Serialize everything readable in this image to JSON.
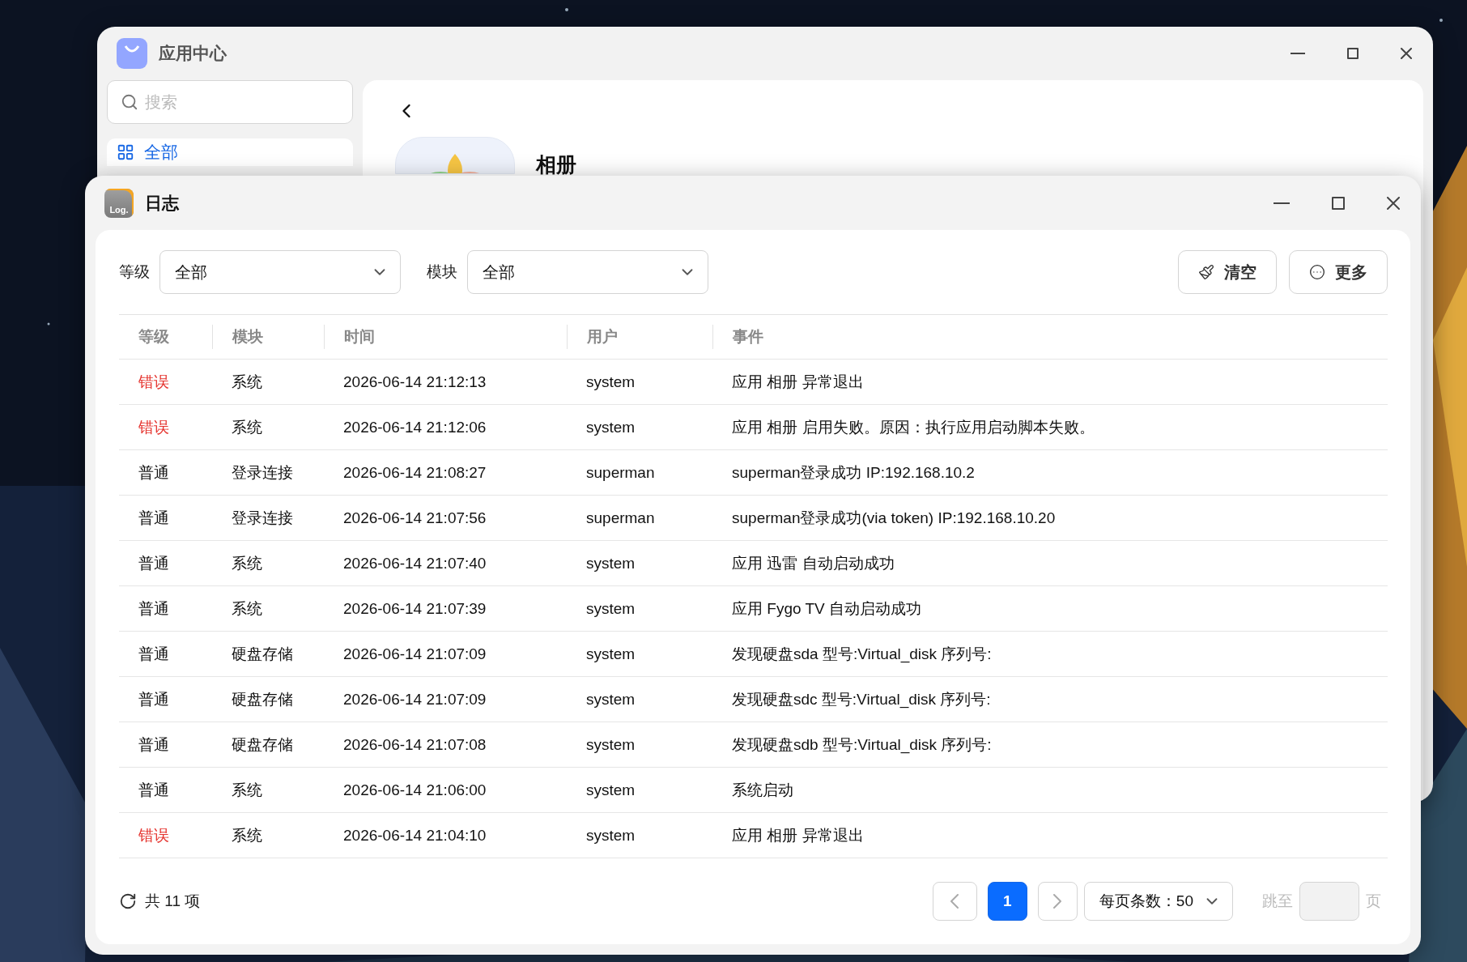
{
  "back_window": {
    "title": "应用中心",
    "search": {
      "placeholder": "搜索"
    },
    "sidebar": {
      "items": [
        {
          "label": "全部",
          "selected": true
        }
      ]
    },
    "app": {
      "name": "相册"
    }
  },
  "window": {
    "title": "日志",
    "icon_label": "Log."
  },
  "filters": [
    {
      "label": "等级",
      "value": "全部"
    },
    {
      "label": "模块",
      "value": "全部"
    }
  ],
  "actions": [
    {
      "kind": "clear",
      "label": "清空"
    },
    {
      "kind": "more",
      "label": "更多"
    }
  ],
  "table": {
    "columns": [
      "等级",
      "模块",
      "时间",
      "用户",
      "事件"
    ],
    "rows": [
      {
        "level": "错误",
        "color": "#e5322d",
        "module": "系统",
        "time": "2026-06-14 21:12:13",
        "user": "system",
        "event": "应用 相册 异常退出"
      },
      {
        "level": "错误",
        "color": "#e5322d",
        "module": "系统",
        "time": "2026-06-14 21:12:06",
        "user": "system",
        "event": "应用 相册 启用失败。原因：执行应用启动脚本失败。"
      },
      {
        "level": "普通",
        "color": "#111111",
        "module": "登录连接",
        "time": "2026-06-14 21:08:27",
        "user": "superman",
        "event": "superman登录成功 IP:192.168.10.2"
      },
      {
        "level": "普通",
        "color": "#111111",
        "module": "登录连接",
        "time": "2026-06-14 21:07:56",
        "user": "superman",
        "event": "superman登录成功(via token) IP:192.168.10.20"
      },
      {
        "level": "普通",
        "color": "#111111",
        "module": "系统",
        "time": "2026-06-14 21:07:40",
        "user": "system",
        "event": "应用 迅雷 自动启动成功"
      },
      {
        "level": "普通",
        "color": "#111111",
        "module": "系统",
        "time": "2026-06-14 21:07:39",
        "user": "system",
        "event": "应用 Fygo TV 自动启动成功"
      },
      {
        "level": "普通",
        "color": "#111111",
        "module": "硬盘存储",
        "time": "2026-06-14 21:07:09",
        "user": "system",
        "event": "发现硬盘sda 型号:Virtual_disk 序列号:"
      },
      {
        "level": "普通",
        "color": "#111111",
        "module": "硬盘存储",
        "time": "2026-06-14 21:07:09",
        "user": "system",
        "event": "发现硬盘sdc 型号:Virtual_disk 序列号:"
      },
      {
        "level": "普通",
        "color": "#111111",
        "module": "硬盘存储",
        "time": "2026-06-14 21:07:08",
        "user": "system",
        "event": "发现硬盘sdb 型号:Virtual_disk 序列号:"
      },
      {
        "level": "普通",
        "color": "#111111",
        "module": "系统",
        "time": "2026-06-14 21:06:00",
        "user": "system",
        "event": "系统启动"
      },
      {
        "level": "错误",
        "color": "#e5322d",
        "module": "系统",
        "time": "2026-06-14 21:04:10",
        "user": "system",
        "event": "应用 相册 异常退出"
      }
    ]
  },
  "footer": {
    "total": "共 11 项",
    "pages": [
      {
        "label": "1",
        "selected": true
      }
    ],
    "page_size": "每页条数：50",
    "jump_label": "跳至",
    "jump_suffix": "页"
  }
}
